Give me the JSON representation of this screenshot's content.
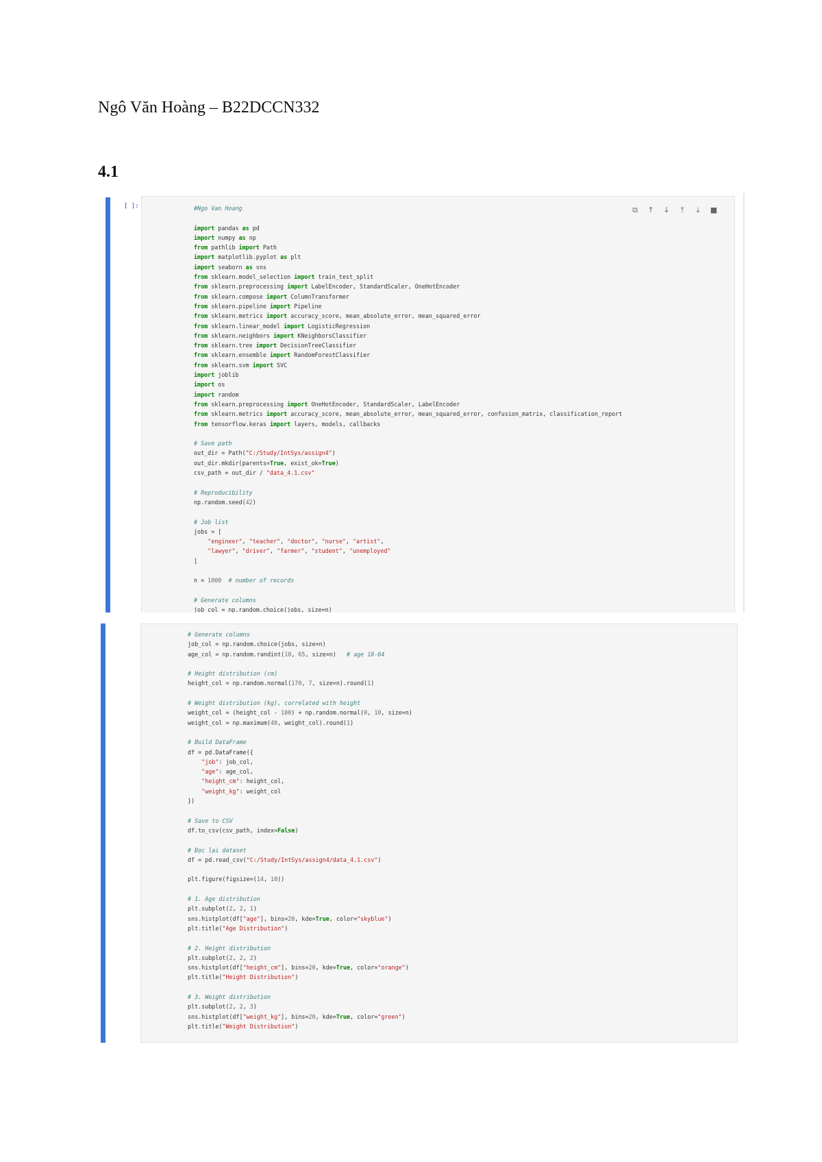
{
  "document": {
    "title": "Ngô Văn Hoàng – B22DCCN332",
    "section": "4.1"
  },
  "cell1": {
    "prompt": "[ ]:",
    "toolbar": [
      {
        "icon": "copy-icon",
        "glyph": "⧉"
      },
      {
        "icon": "arrow-up-icon",
        "glyph": "↑"
      },
      {
        "icon": "arrow-down-icon",
        "glyph": "↓"
      },
      {
        "icon": "insert-above-icon",
        "glyph": "⤒"
      },
      {
        "icon": "insert-below-icon",
        "glyph": "⤓"
      },
      {
        "icon": "delete-icon",
        "glyph": "■"
      }
    ],
    "lines": [
      "#Ngo Van Hoang",
      "",
      "import pandas as pd",
      "import numpy as np",
      "from pathlib import Path",
      "import matplotlib.pyplot as plt",
      "import seaborn as sns",
      "from sklearn.model_selection import train_test_split",
      "from sklearn.preprocessing import LabelEncoder, StandardScaler, OneHotEncoder",
      "from sklearn.compose import ColumnTransformer",
      "from sklearn.pipeline import Pipeline",
      "from sklearn.metrics import accuracy_score, mean_absolute_error, mean_squared_error",
      "from sklearn.linear_model import LogisticRegression",
      "from sklearn.neighbors import KNeighborsClassifier",
      "from sklearn.tree import DecisionTreeClassifier",
      "from sklearn.ensemble import RandomForestClassifier",
      "from sklearn.svm import SVC",
      "import joblib",
      "import os",
      "import random",
      "from sklearn.preprocessing import OneHotEncoder, StandardScaler, LabelEncoder",
      "from sklearn.metrics import accuracy_score, mean_absolute_error, mean_squared_error, confusion_matrix, classification_report",
      "from tensorflow.keras import layers, models, callbacks",
      "",
      "# Save path",
      "out_dir = Path(\"C:/Study/IntSys/assign4\")",
      "out_dir.mkdir(parents=True, exist_ok=True)",
      "csv_path = out_dir / \"data_4.1.csv\"",
      "",
      "# Reproducibility",
      "np.random.seed(42)",
      "",
      "# Job list",
      "jobs = [",
      "    \"engineer\", \"teacher\", \"doctor\", \"nurse\", \"artist\",",
      "    \"lawyer\", \"driver\", \"farmer\", \"student\", \"unemployed\"",
      "]",
      "",
      "n = 1000  # number of records",
      "",
      "# Generate columns",
      "job_col = np.random.choice(jobs, size=n)"
    ]
  },
  "cell2": {
    "lines": [
      "# Generate columns",
      "job_col = np.random.choice(jobs, size=n)",
      "age_col = np.random.randint(18, 65, size=n)   # age 18-64",
      "",
      "# Height distribution (cm)",
      "height_col = np.random.normal(170, 7, size=n).round(1)",
      "",
      "# Weight distribution (kg), correlated with height",
      "weight_col = (height_col - 100) + np.random.normal(0, 10, size=n)",
      "weight_col = np.maximum(40, weight_col).round(1)",
      "",
      "# Build DataFrame",
      "df = pd.DataFrame({",
      "    \"job\": job_col,",
      "    \"age\": age_col,",
      "    \"height_cm\": height_col,",
      "    \"weight_kg\": weight_col",
      "})",
      "",
      "# Save to CSV",
      "df.to_csv(csv_path, index=False)",
      "",
      "# Đọc lại dataset",
      "df = pd.read_csv(\"C:/Study/IntSys/assign4/data_4.1.csv\")",
      "",
      "plt.figure(figsize=(14, 10))",
      "",
      "# 1. Age distribution",
      "plt.subplot(2, 2, 1)",
      "sns.histplot(df[\"age\"], bins=20, kde=True, color=\"skyblue\")",
      "plt.title(\"Age Distribution\")",
      "",
      "# 2. Height distribution",
      "plt.subplot(2, 2, 2)",
      "sns.histplot(df[\"height_cm\"], bins=20, kde=True, color=\"orange\")",
      "plt.title(\"Height Distribution\")",
      "",
      "# 3. Weight distribution",
      "plt.subplot(2, 2, 3)",
      "sns.histplot(df[\"weight_kg\"], bins=20, kde=True, color=\"green\")",
      "plt.title(\"Weight Distribution\")"
    ]
  }
}
